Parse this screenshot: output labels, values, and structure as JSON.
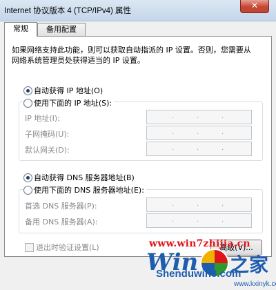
{
  "window": {
    "title": "Internet 协议版本 4 (TCP/IPv4) 属性",
    "close_glyph": "✕"
  },
  "tabs": [
    {
      "label": "常规",
      "active": true
    },
    {
      "label": "备用配置",
      "active": false
    }
  ],
  "description": "如果网络支持此功能，则可以获取自动指派的 IP 设置。否则，您需要从网络系统管理员处获得适当的 IP 设置。",
  "ip": {
    "auto_label": "自动获得 IP 地址(O)",
    "auto_selected": true,
    "manual_label": "使用下面的 IP 地址(S):",
    "manual_selected": false,
    "fields": [
      {
        "label": "IP 地址(I):",
        "value": ""
      },
      {
        "label": "子网掩码(U):",
        "value": ""
      },
      {
        "label": "默认网关(D):",
        "value": ""
      }
    ]
  },
  "dns": {
    "auto_label": "自动获得 DNS 服务器地址(B)",
    "auto_selected": true,
    "manual_label": "使用下面的 DNS 服务器地址(E):",
    "manual_selected": false,
    "fields": [
      {
        "label": "首选 DNS 服务器(P):",
        "value": ""
      },
      {
        "label": "备用 DNS 服务器(A):",
        "value": ""
      }
    ]
  },
  "validate": {
    "label": "退出时验证设置(L)",
    "checked": false
  },
  "advanced_button": "高级(V)...",
  "ip_separator": ".",
  "watermark": {
    "top_text": "www.win7zhijia.cn",
    "win_text": "Win",
    "cn_text": "之家",
    "domain": "Shenduwin8.com",
    "url": "www.kxinyk.com"
  }
}
